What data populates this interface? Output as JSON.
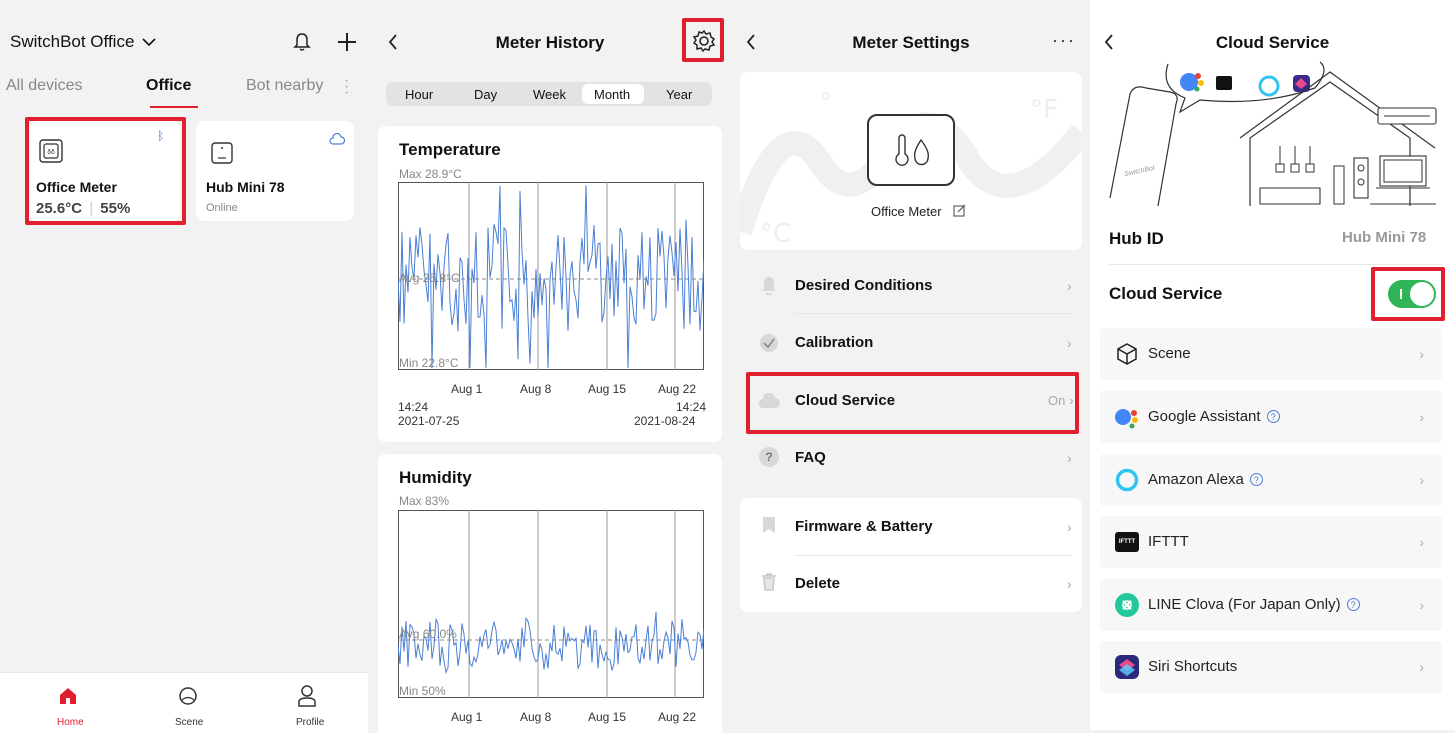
{
  "home": {
    "title": "SwitchBot Office",
    "tabs": [
      "All devices",
      "Office",
      "Bot nearby"
    ],
    "devices": [
      {
        "name": "Office Meter",
        "temp": "25.6°C",
        "humidity": "55%"
      },
      {
        "name": "Hub Mini 78",
        "status": "Online"
      }
    ],
    "nav": [
      "Home",
      "Scene",
      "Profile"
    ],
    "accent": "#e0202e"
  },
  "history": {
    "title": "Meter History",
    "ranges": [
      "Hour",
      "Day",
      "Week",
      "Month",
      "Year"
    ],
    "selected_range": "Month",
    "temperature": {
      "title": "Temperature",
      "max": "Max 28.9°C",
      "avg": "Avg 25.8°C",
      "min": "Min 22.8°C",
      "ticks": [
        "Aug 1",
        "Aug 8",
        "Aug 15",
        "Aug 22"
      ],
      "start_time": "14:24",
      "start_date": "2021-07-25",
      "end_time": "14:24",
      "end_date": "2021-08-24"
    },
    "humidity": {
      "title": "Humidity",
      "max": "Max 83%",
      "avg": "Avg 60.0%",
      "min": "Min 50%",
      "ticks": [
        "Aug 1",
        "Aug 8",
        "Aug 15",
        "Aug 22"
      ]
    }
  },
  "settings": {
    "title": "Meter Settings",
    "device_name": "Office Meter",
    "rows": [
      {
        "label": "Desired Conditions",
        "value": ""
      },
      {
        "label": "Calibration",
        "value": ""
      },
      {
        "label": "Cloud Service",
        "value": "On"
      },
      {
        "label": "FAQ",
        "value": ""
      },
      {
        "label": "Firmware & Battery",
        "value": ""
      },
      {
        "label": "Delete",
        "value": ""
      }
    ]
  },
  "cloud": {
    "title": "Cloud Service",
    "hub_id_label": "Hub ID",
    "hub_id_value": "Hub Mini 78",
    "cloud_service_label": "Cloud Service",
    "cloud_enabled": true,
    "phone_label": "SwitchBot",
    "services": [
      {
        "label": "Scene",
        "help": false
      },
      {
        "label": "Google Assistant",
        "help": true
      },
      {
        "label": "Amazon Alexa",
        "help": true
      },
      {
        "label": "IFTTT",
        "help": false
      },
      {
        "label": "LINE Clova (For Japan Only)",
        "help": true
      },
      {
        "label": "Siri Shortcuts",
        "help": false
      }
    ],
    "toggle_color": "#2fb457"
  }
}
